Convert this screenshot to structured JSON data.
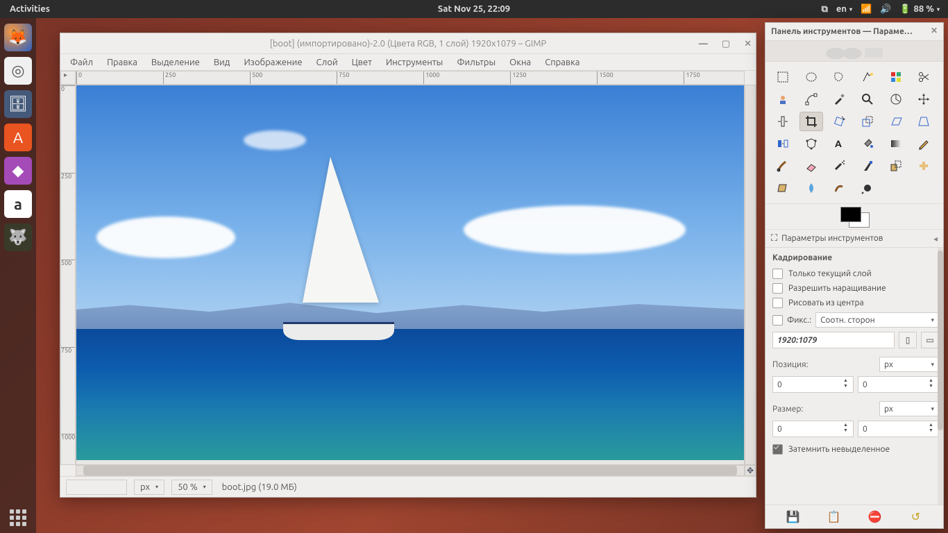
{
  "topbar": {
    "activities": "Activities",
    "datetime": "Sat Nov 25, 22:09",
    "lang": "en",
    "battery": "88 %"
  },
  "dock": {
    "items": [
      "firefox",
      "rhythmbox",
      "files",
      "software",
      "system-settings",
      "amazon",
      "gimp"
    ],
    "amazon_label": "a"
  },
  "gimp_window": {
    "title": "[boot] (импортировано)-2.0 (Цвета RGB, 1 слой) 1920x1079 – GIMP",
    "menus": [
      "Файл",
      "Правка",
      "Выделение",
      "Вид",
      "Изображение",
      "Слой",
      "Цвет",
      "Инструменты",
      "Фильтры",
      "Окна",
      "Справка"
    ],
    "ruler_h": [
      "0",
      "250",
      "500",
      "750",
      "1000",
      "1250",
      "1500",
      "1750"
    ],
    "ruler_v": [
      "0",
      "250",
      "500",
      "750",
      "1000"
    ],
    "status": {
      "unit": "px",
      "zoom": "50 %",
      "msg": "boot.jpg (19.0 МБ)"
    }
  },
  "toolbox": {
    "title": "Панель инструментов — Параме…",
    "tools": [
      "rect-select",
      "ellipse-select",
      "free-select",
      "fuzzy-select",
      "by-color-select",
      "scissors",
      "foreground-select",
      "paths",
      "color-picker",
      "zoom",
      "measure",
      "move",
      "align",
      "crop",
      "rotate",
      "scale",
      "shear",
      "perspective",
      "flip",
      "cage",
      "text",
      "bucket-fill",
      "blend",
      "pencil",
      "paintbrush",
      "eraser",
      "airbrush",
      "ink",
      "clone",
      "heal",
      "perspective-clone",
      "blur",
      "smudge",
      "dodge"
    ],
    "selected_tool_index": 13,
    "options_tab": "Параметры инструментов",
    "options": {
      "title": "Кадрирование",
      "current_layer_only": "Только текущий слой",
      "allow_growing": "Разрешить наращивание",
      "expand_from_center": "Рисовать из центра",
      "fixed_label": "Фикс.:",
      "fixed_mode": "Соотн. сторон",
      "aspect_value": "1920:1079",
      "position_label": "Позиция:",
      "pos_unit": "px",
      "pos_x": "0",
      "pos_y": "0",
      "size_label": "Размер:",
      "size_unit": "px",
      "size_w": "0",
      "size_h": "0",
      "highlight": "Затемнить невыделенное",
      "highlight_checked": true
    }
  }
}
